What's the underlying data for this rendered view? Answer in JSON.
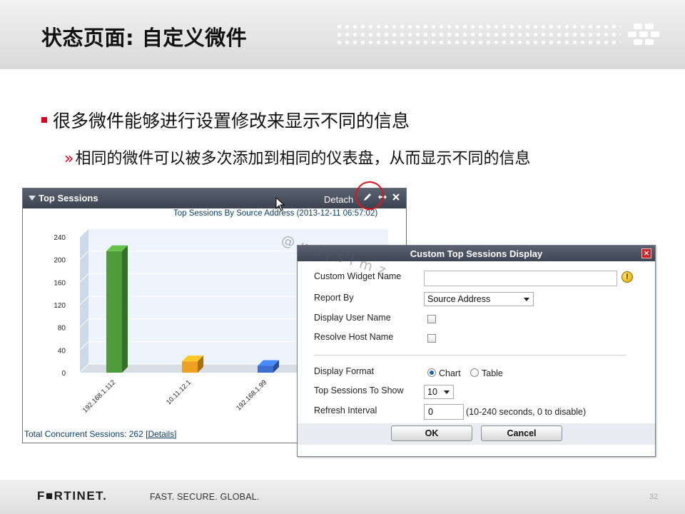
{
  "slide": {
    "title": "状态页面: 自定义微件",
    "bullet1": "很多微件能够进行设置修改来显示不同的信息",
    "bullet2_marker": "»",
    "bullet2": "相同的微件可以被多次添加到相同的仪表盘，从而显示不同的信息"
  },
  "widget": {
    "title": "Top Sessions",
    "detach_label": "Detach",
    "icons": [
      "collapse-icon",
      "edit-pencil-icon",
      "move-arrows-icon",
      "close-icon"
    ],
    "subtitle": "Top Sessions By Source Address (2013-12-11 06:57:02)",
    "footer_text": "Total Concurrent Sessions: 262",
    "footer_link": "[Details]"
  },
  "chart_data": {
    "type": "bar",
    "categories": [
      "192.168.1.112",
      "10.11.12.1",
      "192.168.1.99"
    ],
    "values": [
      215,
      20,
      12
    ],
    "colors": [
      "#4f9d3a",
      "#f0a020",
      "#3c6fd0"
    ],
    "ylim": [
      0,
      240
    ],
    "yticks": [
      "240",
      "200",
      "160",
      "120",
      "80",
      "40",
      "0"
    ],
    "grid": true
  },
  "dialog": {
    "title": "Custom Top Sessions Display",
    "close_label": "×",
    "fields": {
      "widget_name_label": "Custom Widget Name",
      "widget_name_value": "",
      "report_by_label": "Report By",
      "report_by_value": "Source Address",
      "display_user_label": "Display User Name",
      "resolve_host_label": "Resolve Host Name",
      "display_format_label": "Display Format",
      "format_chart": "Chart",
      "format_table": "Table",
      "top_sessions_label": "Top Sessions To Show",
      "top_sessions_value": "10",
      "refresh_label": "Refresh Interval",
      "refresh_value": "0",
      "refresh_hint": "(10-240 seconds, 0 to disable)"
    },
    "ok_label": "OK",
    "cancel_label": "Cancel",
    "warning_glyph": "!"
  },
  "watermark": "@wljslmz",
  "footer": {
    "brand": "F■RTINET.",
    "tagline": "FAST. SECURE. GLOBAL.",
    "page_number": "32"
  },
  "colors": {
    "accent_red": "#d6001c",
    "titlebar": "#444b58",
    "link_blue": "#0a3d66"
  }
}
